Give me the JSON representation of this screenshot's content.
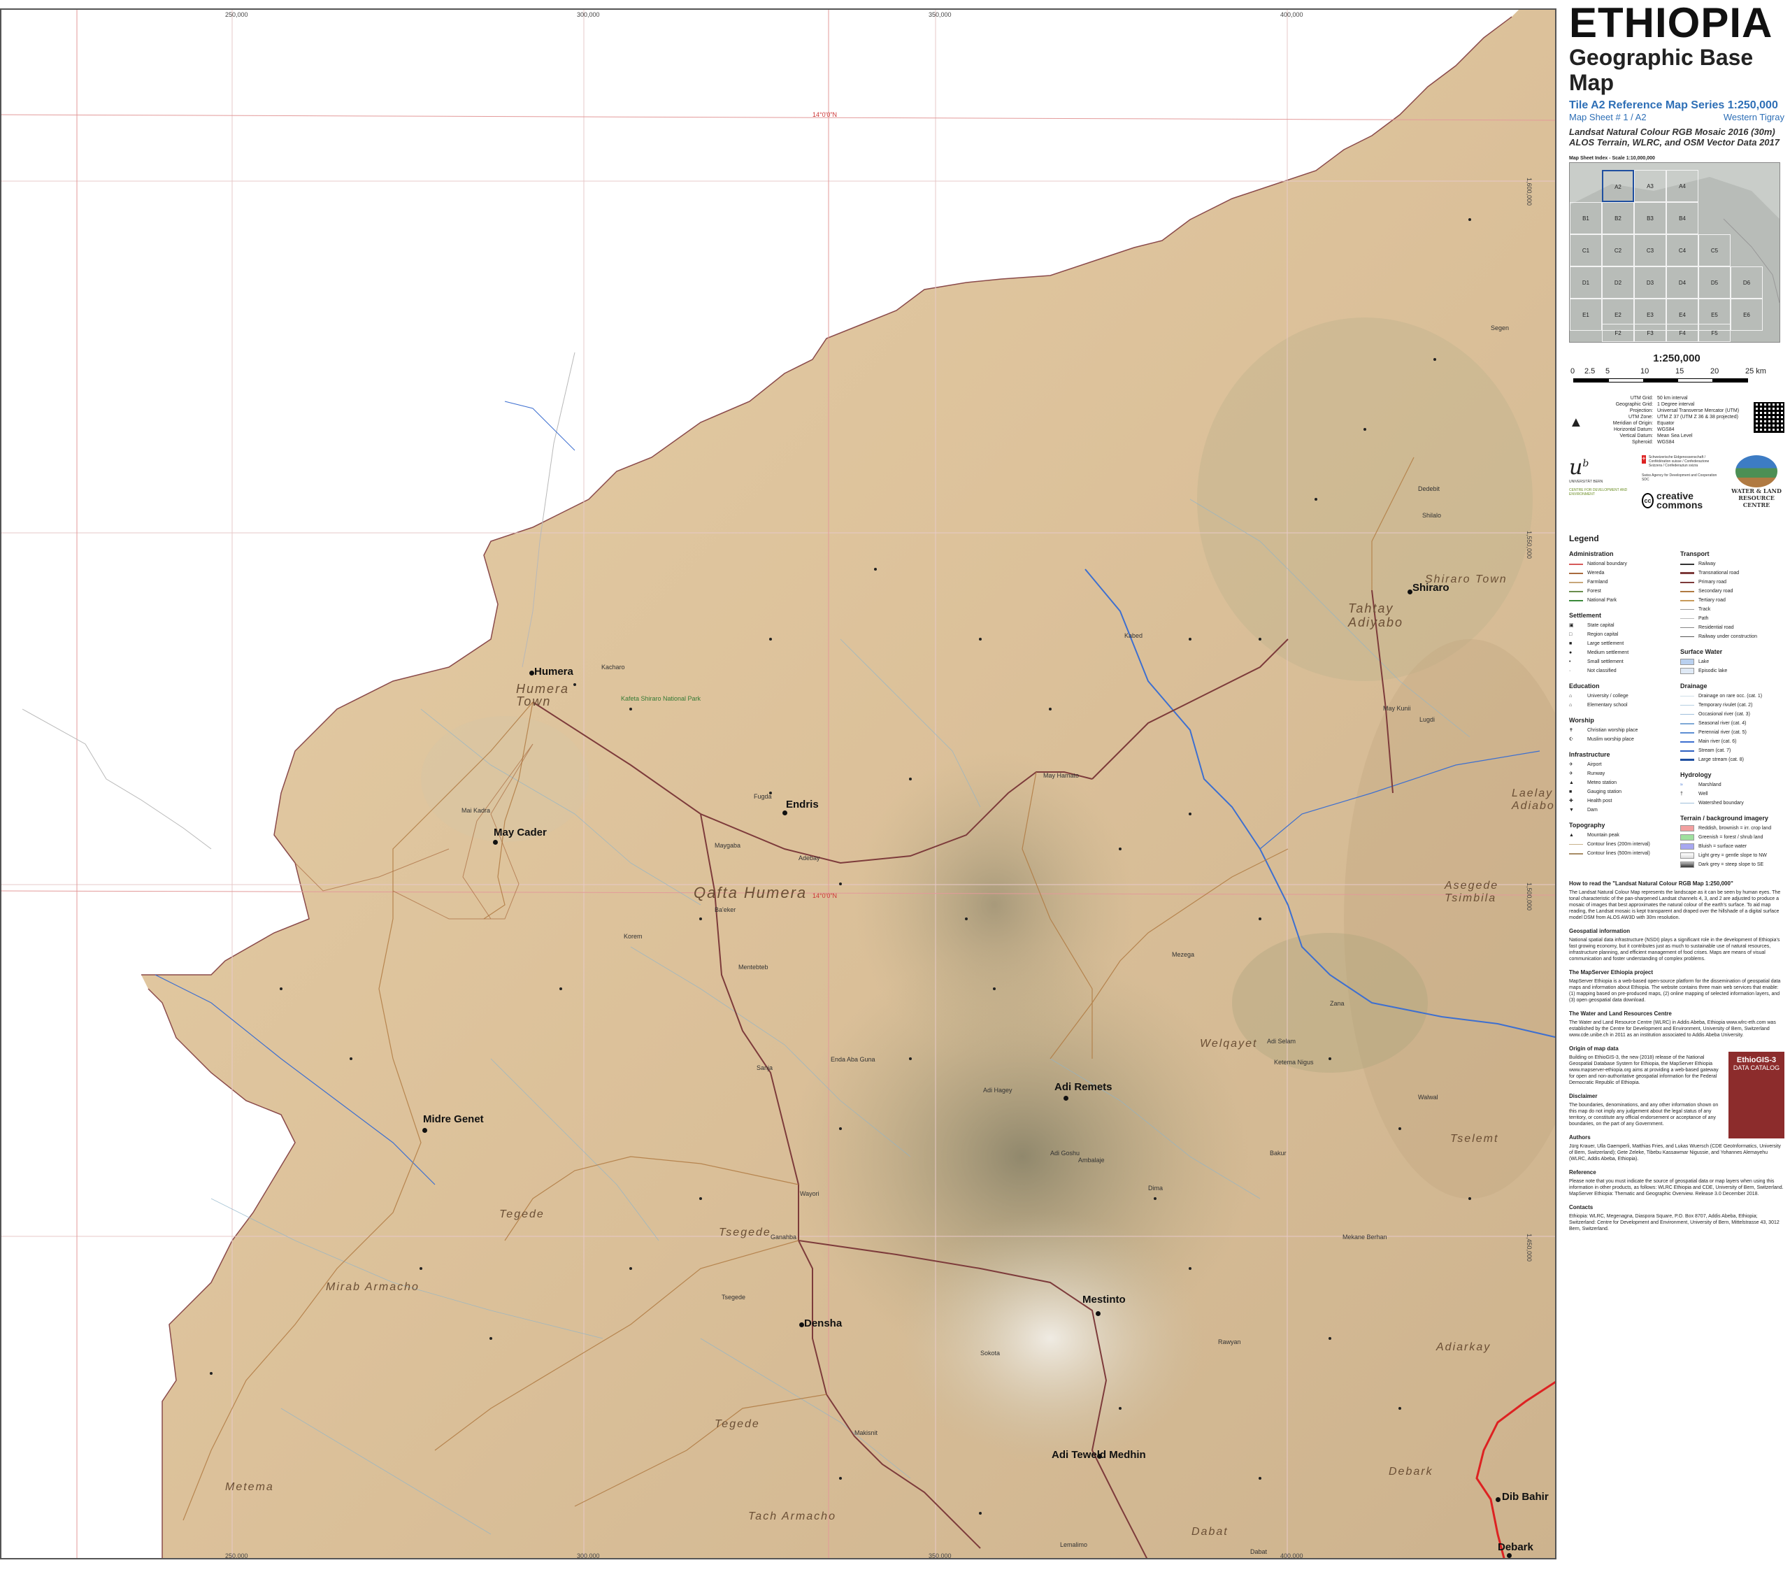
{
  "header": {
    "title": "ETHIOPIA",
    "subtitle": "Geographic Base Map",
    "tile_line": "Tile A2  Reference Map Series 1:250,000",
    "sheet_number": "Map Sheet #  1 / A2",
    "sheet_region": "Western Tigray",
    "source_line1": "Landsat Natural Colour RGB Mosaic 2016 (30m)",
    "source_line2": "ALOS Terrain, WLRC, and OSM Vector Data 2017"
  },
  "index_map": {
    "label": "Map Sheet Index - Scale 1:10,000,000",
    "cells": [
      "A2",
      "A3",
      "A4",
      "B1",
      "B2",
      "B3",
      "B4",
      "C1",
      "C2",
      "C3",
      "C4",
      "C5",
      "D1",
      "D2",
      "D3",
      "D4",
      "D5",
      "D6",
      "E1",
      "E2",
      "E3",
      "E4",
      "E5",
      "E6",
      "F2",
      "F3",
      "F4",
      "F5"
    ],
    "selected": "A2"
  },
  "scale": {
    "title": "1:250,000",
    "ticks": [
      "0",
      "2.5",
      "5",
      "10",
      "15",
      "20",
      "25 km"
    ]
  },
  "grid_meta": [
    {
      "k": "UTM Grid:",
      "v": "50 km interval"
    },
    {
      "k": "Geographic Grid:",
      "v": "1 Degree interval"
    },
    {
      "k": "Projection:",
      "v": "Universal Transverse Mercator (UTM)"
    },
    {
      "k": "UTM Zone:",
      "v": "UTM Z 37 (UTM Z 36 & 38 projected)"
    },
    {
      "k": "Meridian of Origin:",
      "v": "Equator"
    },
    {
      "k": "Horizontal Datum:",
      "v": "WGS84"
    },
    {
      "k": "Vertical Datum:",
      "v": "Mean Sea Level"
    },
    {
      "k": "Spheroid:",
      "v": "WGS84"
    }
  ],
  "logos": {
    "unibe": "UNIVERSITÄT BERN",
    "cde": "CENTRE FOR DEVELOPMENT AND ENVIRONMENT",
    "swiss": "Schweizerische Eidgenossenschaft / Confédération suisse / Confederazione Svizzera / Confederaziun svizra",
    "sdc": "Swiss Agency for Development and Cooperation SDC",
    "cc": "creative commons",
    "wlrc": "WATER & LAND RESOURCE CENTRE"
  },
  "legend": {
    "title": "Legend",
    "administration": {
      "head": "Administration",
      "items": [
        "National boundary",
        "Wereda",
        "Farmland",
        "Forest",
        "National Park"
      ]
    },
    "settlement": {
      "head": "Settlement",
      "items": [
        "State capital",
        "Region capital",
        "Large settlement",
        "Medium settlement",
        "Small settlement",
        "Not classified"
      ]
    },
    "education": {
      "head": "Education",
      "items": [
        "University / college",
        "Elementary school"
      ]
    },
    "worship": {
      "head": "Worship",
      "items": [
        "Christian worship place",
        "Muslim worship place"
      ]
    },
    "infrastructure": {
      "head": "Infrastructure",
      "items": [
        "Airport",
        "Runway",
        "Meteo station",
        "Gauging station",
        "Health post",
        "Dam"
      ]
    },
    "topography": {
      "head": "Topography",
      "items": [
        "Mountain peak",
        "Contour lines (200m interval)",
        "Contour lines (500m interval)"
      ]
    },
    "transport": {
      "head": "Transport",
      "items": [
        "Railway",
        "Transnational road",
        "Primary road",
        "Secondary road",
        "Tertiary road",
        "Track",
        "Path",
        "Residential road",
        "Railway under construction"
      ]
    },
    "surface_water": {
      "head": "Surface Water",
      "items": [
        "Lake",
        "Episodic lake"
      ]
    },
    "drainage": {
      "head": "Drainage",
      "items": [
        "Drainage on rare occ. (cat. 1)",
        "Temporary rivulet (cat. 2)",
        "Occasional river (cat. 3)",
        "Seasonal river (cat. 4)",
        "Perennial river (cat. 5)",
        "Main river (cat. 6)",
        "Stream (cat. 7)",
        "Large stream (cat. 8)"
      ]
    },
    "hydrology": {
      "head": "Hydrology",
      "items": [
        "Marshland",
        "Well",
        "Watershed boundary"
      ]
    },
    "terrain": {
      "head": "Terrain / background imagery",
      "items": [
        "Reddish, brownish = irr. crop land",
        "Greenish = forest / shrub land",
        "Bluish = surface water",
        "Light grey = gentle slope to NW",
        "Dark grey = steep slope to SE"
      ]
    }
  },
  "text_sections": [
    {
      "head": "How to read the \"Landsat Natural Colour RGB Map 1:250,000\"",
      "body": "The Landsat Natural Colour Map represents the landscape as it can be seen by human eyes. The tonal characteristic of the pan-sharpened Landsat channels 4, 3, and 2 are adjusted to produce a mosaic of images that best approximates the natural colour of the earth's surface. To aid map reading, the Landsat mosaic is kept transparent and draped over the hillshade of a digital surface model DSM from ALOS AW3D with 30m resolution."
    },
    {
      "head": "Geospatial information",
      "body": "National spatial data infrastructure (NSDI) plays a significant role in the development of Ethiopia's fast growing economy, but it contributes just as much to sustainable use of natural resources, infrastructure planning, and efficient management of food crises. Maps are means of visual communication and foster understanding of complex problems."
    },
    {
      "head": "The MapServer Ethiopia project",
      "body": "MapServer Ethiopia is a web-based open-source platform for the dissemination of geospatial data maps and information about Ethiopia. The website contains three main web services that enable: (1) mapping based on pre-produced maps, (2) online mapping of selected information layers, and (3) open geospatial data download."
    },
    {
      "head": "The Water and Land Resources Centre",
      "body": "The Water and Land Resource Centre (WLRC) in Addis Abeba, Ethiopia www.wlrc-eth.com was established by the Centre for Development and Environment, University of Bern, Switzerland www.cde.unibe.ch in 2011 as an institution associated to Addis Abeba University."
    },
    {
      "head": "Origin of map data",
      "body": "Building on EthioGIS-3, the new (2018) release of the National Geospatial Database System for Ethiopia, the MapServer Ethiopia www.mapserver-ethiopia.org aims at providing a web-based gateway for open and non-authoritative geospatial information for the Federal Democratic Republic of Ethiopia."
    },
    {
      "head": "Disclaimer",
      "body": "The boundaries, denominations, and any other information shown on this map do not imply any judgement about the legal status of any territory, or constitute any official endorsement or acceptance of any boundaries, on the part of any Government."
    },
    {
      "head": "Authors",
      "body": "Jürg Krauer, Ulla Gaemperli, Matthias Fries, and Lukas Wuersch (CDE GeoInformatics, University of Bern, Switzerland); Gete Zeleke, Tibebu Kassawmar Nigussie, and Yohannes Alemayehu (WLRC, Addis Abeba, Ethiopia)."
    },
    {
      "head": "Reference",
      "body": "Please note that you must indicate the source of geospatial data or map layers when using this information in other products, as follows: WLRC Ethiopia and CDE, University of Bern, Switzerland. MapServer Ethiopia: Thematic and Geographic Overview. Release 3.0 December 2018."
    },
    {
      "head": "Contacts",
      "body": "Ethiopia: WLRC, Megenagna, Diaspora Square, P.O. Box 8707, Addis Abeba, Ethiopia; Switzerland: Centre for Development and Environment, University of Bern, Mittelstrasse 43, 3012 Bern, Switzerland."
    }
  ],
  "catalog": {
    "title": "EthioGIS-3",
    "subtitle": "DATA CATALOG"
  },
  "map": {
    "top_coords": [
      "250,000",
      "300,000",
      "350,000",
      "400,000"
    ],
    "bottom_coords": [
      "250,000",
      "300,000",
      "350,000",
      "400,000"
    ],
    "right_coords": [
      "1,600,000",
      "1,550,000",
      "1,500,000",
      "1,450,000"
    ],
    "lat_labels": [
      "14°0'0\"N",
      "14°0'0\"N",
      "14°0'0\"N"
    ],
    "places_large": [
      {
        "name": "Humera"
      },
      {
        "name": "Endris"
      },
      {
        "name": "May Cader"
      },
      {
        "name": "Adi Remets"
      },
      {
        "name": "Midre Genet"
      },
      {
        "name": "Mestinto"
      },
      {
        "name": "Densha"
      },
      {
        "name": "Adi Teweld Medhin"
      },
      {
        "name": "Shiraro"
      },
      {
        "name": "Dib Bahir"
      },
      {
        "name": "Debark"
      }
    ],
    "regions": [
      {
        "name": "Humera Town"
      },
      {
        "name": "Qafta Humera"
      },
      {
        "name": "Tahtay Adiyabo"
      },
      {
        "name": "Shiraro Town"
      },
      {
        "name": "Laelay Adiabo"
      },
      {
        "name": "Asegede Tsimbila"
      },
      {
        "name": "Welqayet"
      },
      {
        "name": "Tselemt"
      },
      {
        "name": "Tegede"
      },
      {
        "name": "Tsegede"
      },
      {
        "name": "Mirab Armacho"
      },
      {
        "name": "Adiarkay"
      },
      {
        "name": "Tegede"
      },
      {
        "name": "Debark"
      },
      {
        "name": "Metema"
      },
      {
        "name": "Tach Armacho"
      },
      {
        "name": "Dabat"
      }
    ],
    "small_places": [
      "Kacharo",
      "Kafeta Shiraro National Park",
      "Fugda",
      "Maygaba",
      "Adebay",
      "Ba'eker",
      "Mai Kadra",
      "Korem",
      "Mentebteb",
      "Sanja",
      "Wayori",
      "Ganahba",
      "Makisnit",
      "Adi Hagey",
      "Mezega",
      "Ketema Nigus",
      "Enda Aba Guna",
      "May Hamato",
      "Tsegede",
      "Adi Goshu",
      "Rawyan",
      "Ambalaje",
      "Dima",
      "Adi Selam",
      "Zana",
      "May Kunii",
      "Shilalo",
      "Dedebit",
      "Segen",
      "Lugdi",
      "Kabed",
      "Walwal",
      "Bakur",
      "Mekane Berhan",
      "Sokota",
      "Lemalimo",
      "Dabat"
    ]
  }
}
